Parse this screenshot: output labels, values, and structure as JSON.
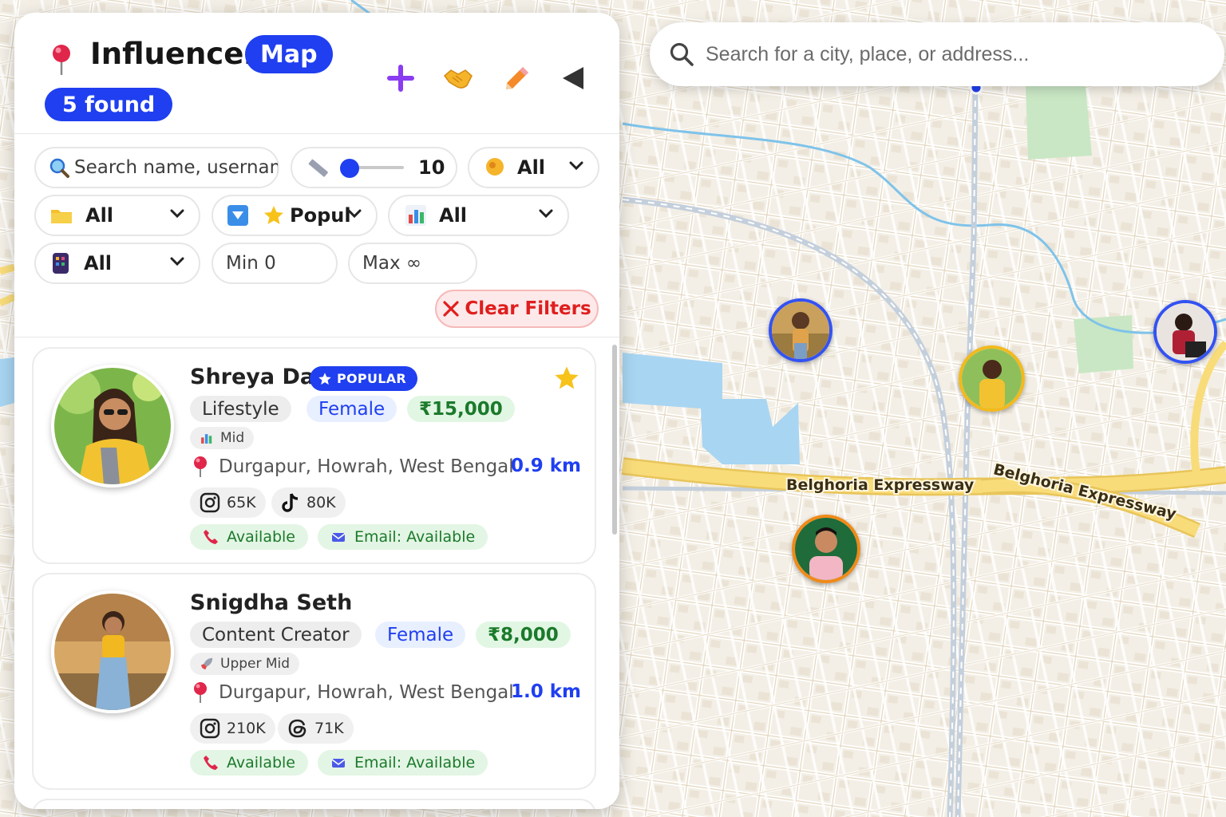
{
  "panel": {
    "title": "Influencer",
    "title_pill": "Map",
    "found_count": "5 found",
    "header_icons": [
      "plus-icon",
      "handshake-icon",
      "pencil-icon",
      "collapse-triangle-icon"
    ]
  },
  "filters": {
    "search_placeholder": "Search name, usernam",
    "radius_value": "10",
    "gender_selected": "All",
    "category_selected": "All",
    "sort_selected": "Popul",
    "tier_selected": "All",
    "platform_selected": "All",
    "min_placeholder": "Min 0",
    "max_placeholder": "Max ∞",
    "clear_label": "Clear Filters",
    "radius_fraction": 0.0
  },
  "map": {
    "search_placeholder": "Search for a city, place, or address...",
    "road_labels": [
      "Belghoria Expressway",
      "Belghoria Expressway"
    ]
  },
  "influencers": [
    {
      "name": "Shreya Das",
      "badge": "POPULAR",
      "favorite": true,
      "category": "Lifestyle",
      "gender": "Female",
      "price": "₹15,000",
      "tier": "Mid",
      "location": "Durgapur, Howrah, West Bengal",
      "distance": "0.9 km",
      "socials": [
        {
          "platform": "instagram-icon",
          "count": "65K"
        },
        {
          "platform": "tiktok-icon",
          "count": "80K"
        }
      ],
      "phone": "Available",
      "email": "Email: Available"
    },
    {
      "name": "Snigdha Seth",
      "category": "Content Creator",
      "gender": "Female",
      "price": "₹8,000",
      "tier": "Upper Mid",
      "location": "Durgapur, Howrah, West Bengal",
      "distance": "1.0 km",
      "socials": [
        {
          "platform": "instagram-icon",
          "count": "210K"
        },
        {
          "platform": "threads-icon",
          "count": "71K"
        }
      ],
      "phone": "Available",
      "email": "Email: Available"
    }
  ],
  "colors": {
    "accent": "#1f3ff0",
    "price_green": "#1b7a2b",
    "clear_red": "#e01e1e",
    "map_bg": "#f3efe6",
    "water": "#a8d5f2",
    "expressway": "#f9dc7a"
  }
}
